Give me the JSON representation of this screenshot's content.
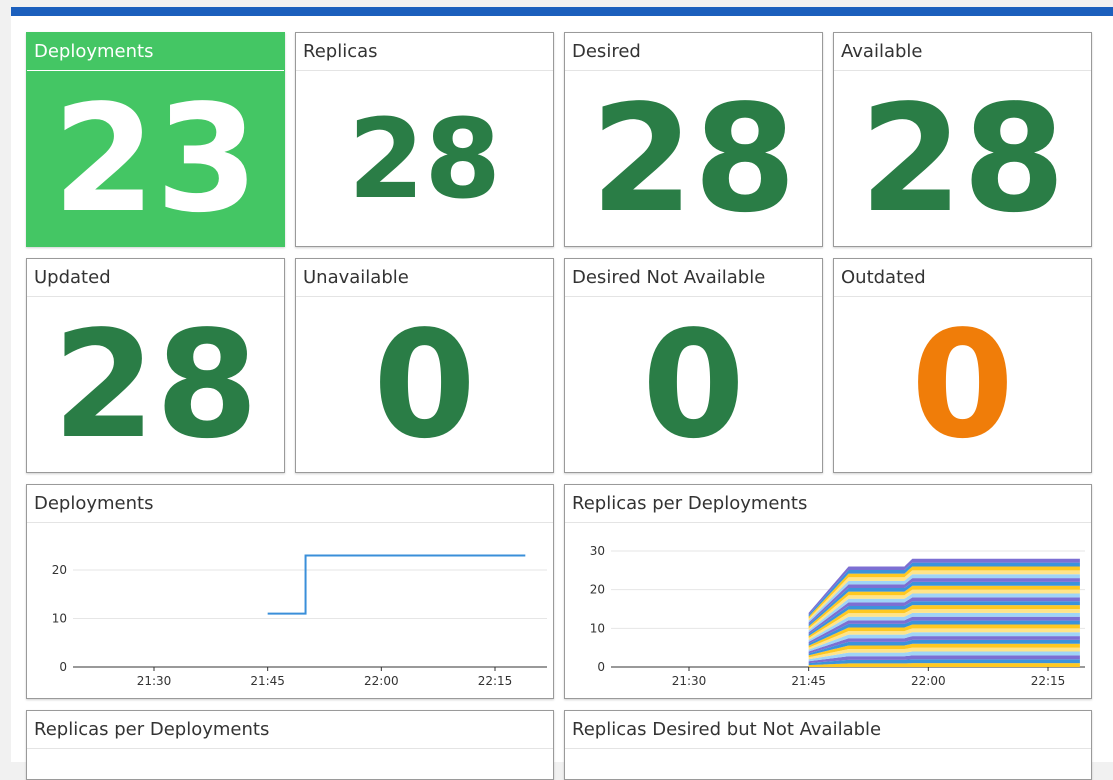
{
  "dashboard": {
    "accent_color": "#1b5fbd",
    "stats": [
      {
        "title": "Deployments",
        "value": "23",
        "highlight": "#44c664",
        "color": "#ffffff"
      },
      {
        "title": "Replicas",
        "value": "28",
        "color": "#2a7d46"
      },
      {
        "title": "Desired",
        "value": "28",
        "color": "#2a7d46"
      },
      {
        "title": "Available",
        "value": "28",
        "color": "#2a7d46"
      },
      {
        "title": "Updated",
        "value": "28",
        "color": "#2a7d46"
      },
      {
        "title": "Unavailable",
        "value": "0",
        "color": "#2a7d46"
      },
      {
        "title": "Desired Not Available",
        "value": "0",
        "color": "#2a7d46"
      },
      {
        "title": "Outdated",
        "value": "0",
        "color": "#f07d09"
      }
    ],
    "panels": [
      {
        "title": "Deployments"
      },
      {
        "title": "Replicas per Deployments"
      },
      {
        "title": "Replicas per Deployments"
      },
      {
        "title": "Replicas Desired but Not Available"
      }
    ]
  },
  "chart_data": [
    {
      "type": "line",
      "title": "Deployments",
      "x_ticks": [
        "21:30",
        "21:45",
        "22:00",
        "22:15"
      ],
      "y_ticks": [
        "0",
        "10",
        "20"
      ],
      "ylim": [
        0,
        28
      ],
      "grid": true,
      "series": [
        {
          "color": "#3a8fd9",
          "points": [
            [
              "21:45",
              11
            ],
            [
              "21:50",
              11
            ],
            [
              "21:50",
              23
            ],
            [
              "22:19",
              23
            ]
          ]
        }
      ]
    },
    {
      "type": "area",
      "title": "Replicas per Deployments",
      "stacked": true,
      "x_ticks": [
        "21:30",
        "21:45",
        "22:00",
        "22:15"
      ],
      "y_ticks": [
        "0",
        "10",
        "20",
        "30"
      ],
      "ylim": [
        0,
        31
      ],
      "grid": true,
      "colors": [
        "#ffc820",
        "#3b93dc",
        "#7c6fd3",
        "#9fd4f7",
        "#ffe48a"
      ],
      "totals": [
        {
          "x": "21:45",
          "y": 14
        },
        {
          "x": "21:50",
          "y": 26
        },
        {
          "x": "21:57",
          "y": 26
        },
        {
          "x": "21:58",
          "y": 28
        },
        {
          "x": "22:19",
          "y": 28
        }
      ]
    }
  ]
}
